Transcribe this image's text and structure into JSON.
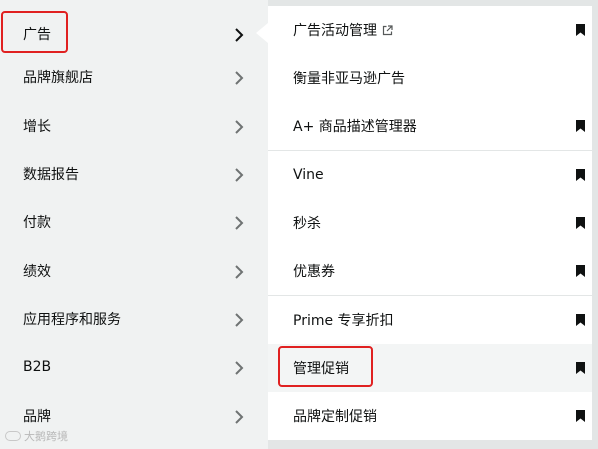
{
  "left_menu": {
    "items": [
      {
        "label": "广告"
      },
      {
        "label": "品牌旗舰店"
      },
      {
        "label": "增长"
      },
      {
        "label": "数据报告"
      },
      {
        "label": "付款"
      },
      {
        "label": "绩效"
      },
      {
        "label": "应用程序和服务"
      },
      {
        "label": "B2B"
      },
      {
        "label": "品牌"
      }
    ],
    "selected": "广告"
  },
  "submenu": {
    "items": [
      {
        "label": "广告活动管理",
        "external": true,
        "bookmarked": true
      },
      {
        "label": "衡量非亚马逊广告",
        "external": false,
        "bookmarked": false
      },
      {
        "label": "A+ 商品描述管理器",
        "external": false,
        "bookmarked": true
      },
      {
        "label": "Vine",
        "external": false,
        "bookmarked": true
      },
      {
        "label": "秒杀",
        "external": false,
        "bookmarked": true
      },
      {
        "label": "优惠券",
        "external": false,
        "bookmarked": true
      },
      {
        "label": "Prime 专享折扣",
        "external": false,
        "bookmarked": true
      },
      {
        "label": "管理促销",
        "external": false,
        "bookmarked": true
      },
      {
        "label": "品牌定制促销",
        "external": false,
        "bookmarked": true
      }
    ],
    "hovered": "管理促销"
  },
  "watermark": {
    "text": "大鹅跨境"
  },
  "icons": {
    "chevron": "chevron-right-icon",
    "bookmark": "bookmark-icon",
    "external": "external-link-icon"
  },
  "colors": {
    "highlight": "#e02121",
    "menu_bg": "#f0f2f2",
    "panel_bg": "#ffffff",
    "text": "#0f1111"
  }
}
